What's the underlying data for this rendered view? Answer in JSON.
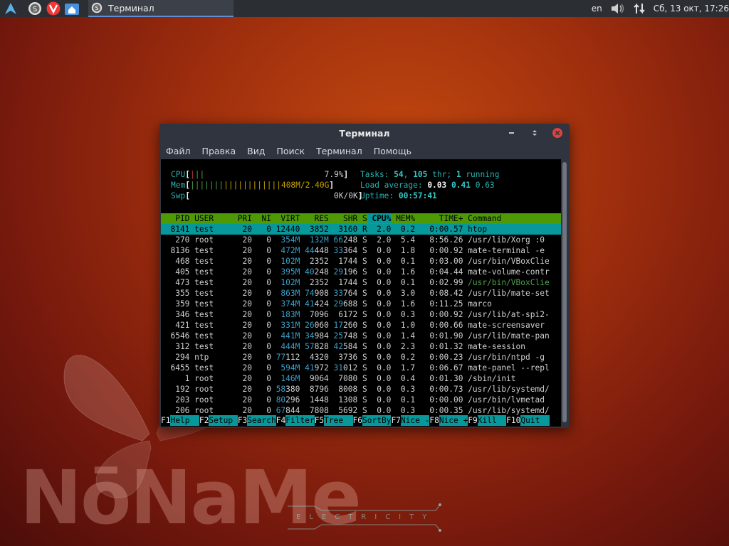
{
  "panel": {
    "window_title": "Терминал",
    "lang": "en",
    "clock": "Сб, 13 окт, 17:26",
    "icons": [
      "arch-menu-icon",
      "app-icon-s",
      "vivaldi-icon",
      "home-folder-icon",
      "volume-icon",
      "network-icon"
    ]
  },
  "window": {
    "title": "Терминал",
    "menu": [
      "Файл",
      "Правка",
      "Вид",
      "Поиск",
      "Терминал",
      "Помощь"
    ]
  },
  "htop": {
    "cpu_label": "CPU",
    "cpu_value": "7.9%",
    "mem_label": "Mem",
    "mem_value": "408M/2.40G",
    "swp_label": "Swp",
    "swp_value": "0K/0K",
    "tasks_label": "Tasks:",
    "tasks": "54",
    "thr": "105",
    "thr_label": "thr;",
    "running": "1",
    "running_label": "running",
    "load_label": "Load average:",
    "load1": "0.03",
    "load5": "0.41",
    "load15": "0.63",
    "uptime_label": "Uptime:",
    "uptime": "00:57:41",
    "columns": [
      "PID",
      "USER",
      "PRI",
      "NI",
      "VIRT",
      "RES",
      "SHR",
      "S",
      "CPU%",
      "MEM%",
      "TIME+",
      "Command"
    ],
    "rows": [
      {
        "pid": "8141",
        "user": "test",
        "pri": "20",
        "ni": "0",
        "virt": "12440",
        "res": "3852",
        "shr": "3160",
        "s": "R",
        "cpu": "2.0",
        "mem": "0.2",
        "time": "0:00.57",
        "cmd": "htop"
      },
      {
        "pid": "270",
        "user": "root",
        "pri": "20",
        "ni": "0",
        "virt": "354M",
        "res": "132M",
        "shr": "66248",
        "s": "S",
        "cpu": "2.0",
        "mem": "5.4",
        "time": "8:56.26",
        "cmd": "/usr/lib/Xorg :0"
      },
      {
        "pid": "8136",
        "user": "test",
        "pri": "20",
        "ni": "0",
        "virt": "472M",
        "res": "44448",
        "shr": "33364",
        "s": "S",
        "cpu": "0.0",
        "mem": "1.8",
        "time": "0:00.92",
        "cmd": "mate-terminal -e"
      },
      {
        "pid": "468",
        "user": "test",
        "pri": "20",
        "ni": "0",
        "virt": "102M",
        "res": "2352",
        "shr": "1744",
        "s": "S",
        "cpu": "0.0",
        "mem": "0.1",
        "time": "0:03.00",
        "cmd": "/usr/bin/VBoxClie"
      },
      {
        "pid": "405",
        "user": "test",
        "pri": "20",
        "ni": "0",
        "virt": "395M",
        "res": "40248",
        "shr": "29196",
        "s": "S",
        "cpu": "0.0",
        "mem": "1.6",
        "time": "0:04.44",
        "cmd": "mate-volume-contr"
      },
      {
        "pid": "473",
        "user": "test",
        "pri": "20",
        "ni": "0",
        "virt": "102M",
        "res": "2352",
        "shr": "1744",
        "s": "S",
        "cpu": "0.0",
        "mem": "0.1",
        "time": "0:02.99",
        "cmd": "/usr/bin/VBoxClie"
      },
      {
        "pid": "355",
        "user": "test",
        "pri": "20",
        "ni": "0",
        "virt": "863M",
        "res": "74908",
        "shr": "33764",
        "s": "S",
        "cpu": "0.0",
        "mem": "3.0",
        "time": "0:08.42",
        "cmd": "/usr/lib/mate-set"
      },
      {
        "pid": "359",
        "user": "test",
        "pri": "20",
        "ni": "0",
        "virt": "374M",
        "res": "41424",
        "shr": "29688",
        "s": "S",
        "cpu": "0.0",
        "mem": "1.6",
        "time": "0:11.25",
        "cmd": "marco"
      },
      {
        "pid": "346",
        "user": "test",
        "pri": "20",
        "ni": "0",
        "virt": "183M",
        "res": "7096",
        "shr": "6172",
        "s": "S",
        "cpu": "0.0",
        "mem": "0.3",
        "time": "0:00.92",
        "cmd": "/usr/lib/at-spi2-"
      },
      {
        "pid": "421",
        "user": "test",
        "pri": "20",
        "ni": "0",
        "virt": "331M",
        "res": "26060",
        "shr": "17260",
        "s": "S",
        "cpu": "0.0",
        "mem": "1.0",
        "time": "0:00.66",
        "cmd": "mate-screensaver"
      },
      {
        "pid": "6546",
        "user": "test",
        "pri": "20",
        "ni": "0",
        "virt": "441M",
        "res": "34984",
        "shr": "25748",
        "s": "S",
        "cpu": "0.0",
        "mem": "1.4",
        "time": "0:01.90",
        "cmd": "/usr/lib/mate-pan"
      },
      {
        "pid": "312",
        "user": "test",
        "pri": "20",
        "ni": "0",
        "virt": "444M",
        "res": "57828",
        "shr": "42584",
        "s": "S",
        "cpu": "0.0",
        "mem": "2.3",
        "time": "0:01.32",
        "cmd": "mate-session"
      },
      {
        "pid": "294",
        "user": "ntp",
        "pri": "20",
        "ni": "0",
        "virt": "77112",
        "res": "4320",
        "shr": "3736",
        "s": "S",
        "cpu": "0.0",
        "mem": "0.2",
        "time": "0:00.23",
        "cmd": "/usr/bin/ntpd -g"
      },
      {
        "pid": "6455",
        "user": "test",
        "pri": "20",
        "ni": "0",
        "virt": "594M",
        "res": "41972",
        "shr": "31012",
        "s": "S",
        "cpu": "0.0",
        "mem": "1.7",
        "time": "0:06.67",
        "cmd": "mate-panel --repl"
      },
      {
        "pid": "1",
        "user": "root",
        "pri": "20",
        "ni": "0",
        "virt": "146M",
        "res": "9064",
        "shr": "7080",
        "s": "S",
        "cpu": "0.0",
        "mem": "0.4",
        "time": "0:01.30",
        "cmd": "/sbin/init"
      },
      {
        "pid": "192",
        "user": "root",
        "pri": "20",
        "ni": "0",
        "virt": "58380",
        "res": "8796",
        "shr": "8008",
        "s": "S",
        "cpu": "0.0",
        "mem": "0.3",
        "time": "0:00.73",
        "cmd": "/usr/lib/systemd/"
      },
      {
        "pid": "203",
        "user": "root",
        "pri": "20",
        "ni": "0",
        "virt": "80296",
        "res": "1448",
        "shr": "1308",
        "s": "S",
        "cpu": "0.0",
        "mem": "0.1",
        "time": "0:00.00",
        "cmd": "/usr/bin/lvmetad"
      },
      {
        "pid": "206",
        "user": "root",
        "pri": "20",
        "ni": "0",
        "virt": "67844",
        "res": "7808",
        "shr": "5692",
        "s": "S",
        "cpu": "0.0",
        "mem": "0.3",
        "time": "0:00.35",
        "cmd": "/usr/lib/systemd/"
      }
    ],
    "fkeys": [
      {
        "num": "F1",
        "label": "Help"
      },
      {
        "num": "F2",
        "label": "Setup"
      },
      {
        "num": "F3",
        "label": "Search"
      },
      {
        "num": "F4",
        "label": "Filter"
      },
      {
        "num": "F5",
        "label": "Tree"
      },
      {
        "num": "F6",
        "label": "SortBy"
      },
      {
        "num": "F7",
        "label": "Nice -"
      },
      {
        "num": "F8",
        "label": "Nice +"
      },
      {
        "num": "F9",
        "label": "Kill"
      },
      {
        "num": "F10",
        "label": "Quit"
      }
    ]
  },
  "wallpaper": {
    "logo": "NōNaMe",
    "tagline": "ELECTRICITY"
  },
  "colors": {
    "header_green": "#4e9a06",
    "selection_cyan": "#06989a",
    "panel_bg": "#2b2e33",
    "window_bg": "#2f343f",
    "close_red": "#d9443f"
  }
}
